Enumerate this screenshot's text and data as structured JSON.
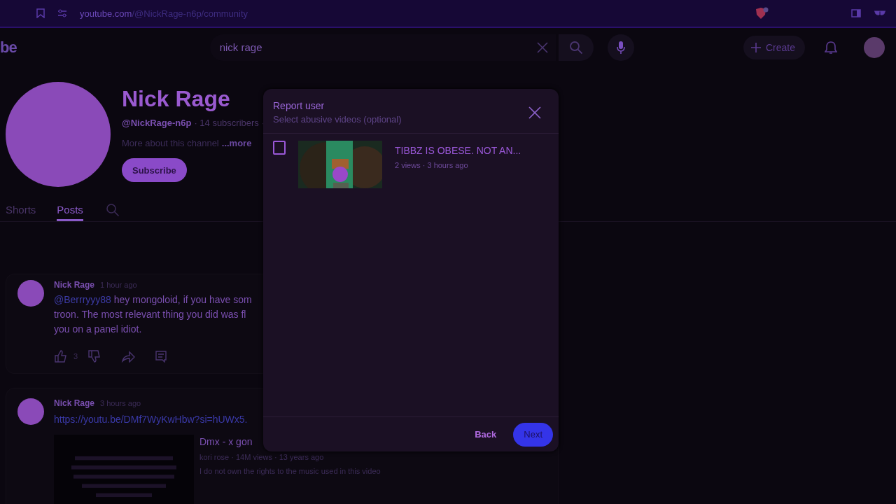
{
  "browser": {
    "url_host": "youtube.com",
    "url_path": "/@NickRage-n6p/community"
  },
  "header": {
    "logo": "be",
    "search": {
      "value": "nick rage"
    },
    "create": "Create"
  },
  "channel": {
    "name": "Nick Rage",
    "handle": "@NickRage-n6p",
    "subscribers": "· 14 subscribers ·",
    "about": "More about this channel",
    "more": "...more",
    "subscribe": "Subscribe"
  },
  "tabs": [
    {
      "label": "Shorts",
      "selected": false
    },
    {
      "label": "Posts",
      "selected": true
    }
  ],
  "posts": [
    {
      "kind": "text",
      "author": "Nick Rage",
      "time": "1 hour ago",
      "mention": "@Berrryyy88",
      "lines": [
        "hey mongoloid, if you have som",
        "troon. The most relevant thing you did was fl",
        "you on a panel idiot."
      ],
      "likes": "3"
    },
    {
      "kind": "video",
      "author": "Nick Rage",
      "time": "3 hours ago",
      "link": "https://youtu.be/DMf7WyKwHbw?si=hUWx5.",
      "video": {
        "title": "Dmx - x gon",
        "meta": "kori rose · 14M views · 13 years ago",
        "description": "I do not own the rights to the music used in this video"
      }
    }
  ],
  "dialog": {
    "title": "Report user",
    "subtitle": "Select abusive videos (optional)",
    "videos": [
      {
        "title": "TIBBZ IS OBESE. NOT AN...",
        "meta": "2 views · 3 hours ago",
        "checked": false
      }
    ],
    "back": "Back",
    "next": "Next"
  }
}
